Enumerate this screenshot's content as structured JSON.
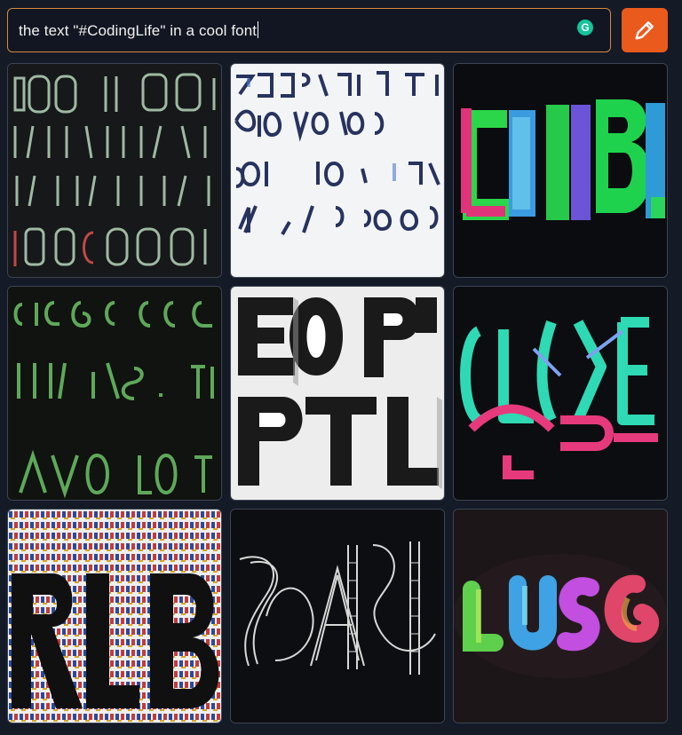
{
  "prompt": {
    "value": "the text \"#CodingLife\" in a cool font",
    "assistant_icon": "grammarly-g-icon",
    "assistant_glyph": "G"
  },
  "generate_button": {
    "icon": "pencil-icon",
    "color": "#ea5a1d"
  },
  "images": [
    {
      "name": "image-1",
      "style": "dark background, green and red scratchy glyph rows"
    },
    {
      "name": "image-2",
      "style": "white background, blue ink letter rows"
    },
    {
      "name": "image-3",
      "style": "black background, neon green/blue/pink block letters"
    },
    {
      "name": "image-4",
      "style": "black background, glowing green letter rows"
    },
    {
      "name": "image-5",
      "style": "white background, bold 3D black and white block letters"
    },
    {
      "name": "image-6",
      "style": "black background, neon teal and pink ribbon letters"
    },
    {
      "name": "image-7",
      "style": "colorful mosaic of tiny letters with large black letters"
    },
    {
      "name": "image-8",
      "style": "black background, white line-drawn letters"
    },
    {
      "name": "image-9",
      "style": "dark background, rainbow glowing 3D letters"
    }
  ]
}
